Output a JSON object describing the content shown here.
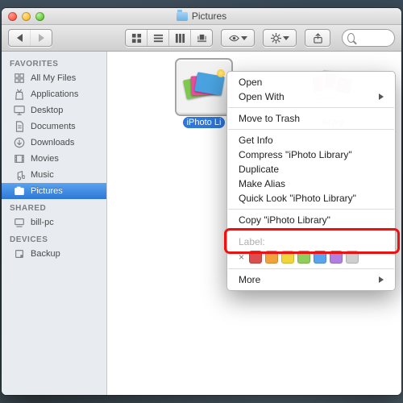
{
  "window": {
    "title": "Pictures"
  },
  "toolbar": {
    "search_placeholder": ""
  },
  "sidebar": {
    "sections": [
      {
        "title": "FAVORITES",
        "items": [
          {
            "label": "All My Files",
            "icon": "all-files-icon"
          },
          {
            "label": "Applications",
            "icon": "applications-icon"
          },
          {
            "label": "Desktop",
            "icon": "desktop-icon"
          },
          {
            "label": "Documents",
            "icon": "documents-icon"
          },
          {
            "label": "Downloads",
            "icon": "downloads-icon"
          },
          {
            "label": "Movies",
            "icon": "movies-icon"
          },
          {
            "label": "Music",
            "icon": "music-icon"
          },
          {
            "label": "Pictures",
            "icon": "pictures-icon",
            "selected": true
          }
        ]
      },
      {
        "title": "SHARED",
        "items": [
          {
            "label": "bill-pc",
            "icon": "shared-pc-icon"
          }
        ]
      },
      {
        "title": "DEVICES",
        "items": [
          {
            "label": "Backup",
            "icon": "disk-icon"
          }
        ]
      }
    ]
  },
  "content": {
    "files": [
      {
        "label": "iPhoto Li",
        "selected": true,
        "kind": "iphoto"
      },
      {
        "label": "ibrary",
        "selected": false,
        "kind": "photos"
      }
    ]
  },
  "context_menu": {
    "items": [
      {
        "label": "Open"
      },
      {
        "label": "Open With",
        "submenu": true
      },
      {
        "sep": true
      },
      {
        "label": "Move to Trash"
      },
      {
        "sep": true
      },
      {
        "label": "Get Info"
      },
      {
        "label": "Compress \"iPhoto Library\""
      },
      {
        "label": "Duplicate"
      },
      {
        "label": "Make Alias"
      },
      {
        "label": "Quick Look \"iPhoto Library\""
      },
      {
        "sep": true
      },
      {
        "label": "Copy \"iPhoto Library\"",
        "highlighted": true
      },
      {
        "sep": true
      },
      {
        "label": "Label:",
        "disabled": true
      },
      {
        "label_row": true,
        "colors": [
          "#d94f4f",
          "#f2a23c",
          "#f2d53c",
          "#8fce5a",
          "#5aa3ef",
          "#b07fe0",
          "#b8b8b8"
        ]
      },
      {
        "sep": true
      },
      {
        "label": "More",
        "submenu": true
      }
    ]
  }
}
